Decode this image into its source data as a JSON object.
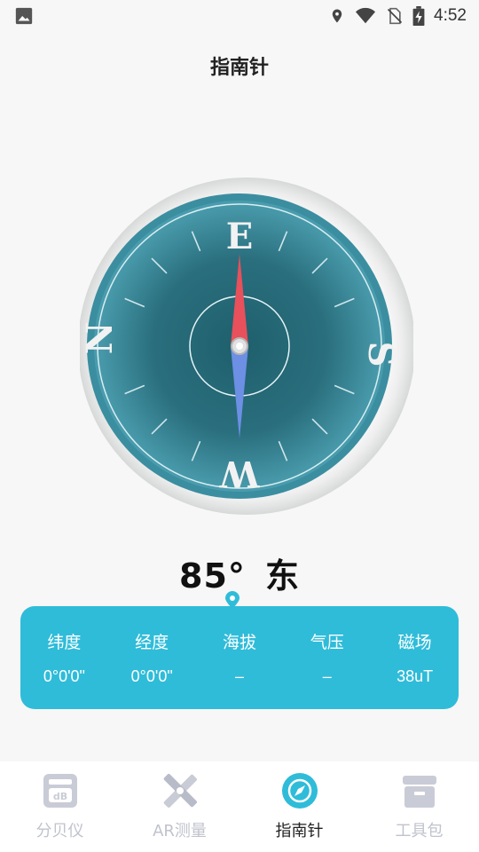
{
  "status_bar": {
    "time": "4:52",
    "icons": [
      "image-icon",
      "location-icon",
      "wifi-icon",
      "no-sim-icon",
      "battery-charging-icon"
    ]
  },
  "header": {
    "title": "指南针"
  },
  "compass": {
    "heading_degrees": 85,
    "labels": {
      "top": "E",
      "right": "S",
      "bottom": "W",
      "left": "N"
    },
    "colors": {
      "dial": "#2e7d8e",
      "needle_north": "#e8505b",
      "needle_south": "#6d8fe4"
    }
  },
  "reading": {
    "degrees": "85°",
    "direction": "东"
  },
  "info": {
    "items": [
      {
        "label": "纬度",
        "value": "0°0'0\""
      },
      {
        "label": "经度",
        "value": "0°0'0\""
      },
      {
        "label": "海拔",
        "value": "–"
      },
      {
        "label": "气压",
        "value": "–"
      },
      {
        "label": "磁场",
        "value": "38uT"
      }
    ]
  },
  "nav": {
    "items": [
      {
        "label": "分贝仪",
        "icon": "decibel-icon",
        "active": false
      },
      {
        "label": "AR测量",
        "icon": "ruler-tools-icon",
        "active": false
      },
      {
        "label": "指南针",
        "icon": "compass-icon",
        "active": true
      },
      {
        "label": "工具包",
        "icon": "toolbox-icon",
        "active": false
      }
    ]
  },
  "colors": {
    "accent": "#2fbcd9",
    "nav_inactive": "#c0c3cd",
    "background": "#f7f7f7"
  }
}
